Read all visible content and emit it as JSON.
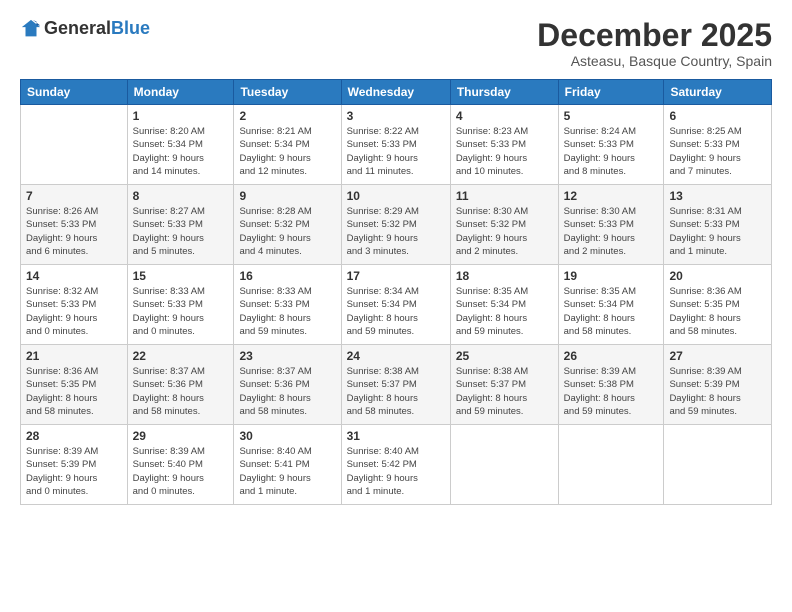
{
  "logo": {
    "general": "General",
    "blue": "Blue"
  },
  "header": {
    "month": "December 2025",
    "location": "Asteasu, Basque Country, Spain"
  },
  "weekdays": [
    "Sunday",
    "Monday",
    "Tuesday",
    "Wednesday",
    "Thursday",
    "Friday",
    "Saturday"
  ],
  "weeks": [
    [
      {
        "day": "",
        "info": ""
      },
      {
        "day": "1",
        "info": "Sunrise: 8:20 AM\nSunset: 5:34 PM\nDaylight: 9 hours\nand 14 minutes."
      },
      {
        "day": "2",
        "info": "Sunrise: 8:21 AM\nSunset: 5:34 PM\nDaylight: 9 hours\nand 12 minutes."
      },
      {
        "day": "3",
        "info": "Sunrise: 8:22 AM\nSunset: 5:33 PM\nDaylight: 9 hours\nand 11 minutes."
      },
      {
        "day": "4",
        "info": "Sunrise: 8:23 AM\nSunset: 5:33 PM\nDaylight: 9 hours\nand 10 minutes."
      },
      {
        "day": "5",
        "info": "Sunrise: 8:24 AM\nSunset: 5:33 PM\nDaylight: 9 hours\nand 8 minutes."
      },
      {
        "day": "6",
        "info": "Sunrise: 8:25 AM\nSunset: 5:33 PM\nDaylight: 9 hours\nand 7 minutes."
      }
    ],
    [
      {
        "day": "7",
        "info": "Sunrise: 8:26 AM\nSunset: 5:33 PM\nDaylight: 9 hours\nand 6 minutes."
      },
      {
        "day": "8",
        "info": "Sunrise: 8:27 AM\nSunset: 5:33 PM\nDaylight: 9 hours\nand 5 minutes."
      },
      {
        "day": "9",
        "info": "Sunrise: 8:28 AM\nSunset: 5:32 PM\nDaylight: 9 hours\nand 4 minutes."
      },
      {
        "day": "10",
        "info": "Sunrise: 8:29 AM\nSunset: 5:32 PM\nDaylight: 9 hours\nand 3 minutes."
      },
      {
        "day": "11",
        "info": "Sunrise: 8:30 AM\nSunset: 5:32 PM\nDaylight: 9 hours\nand 2 minutes."
      },
      {
        "day": "12",
        "info": "Sunrise: 8:30 AM\nSunset: 5:33 PM\nDaylight: 9 hours\nand 2 minutes."
      },
      {
        "day": "13",
        "info": "Sunrise: 8:31 AM\nSunset: 5:33 PM\nDaylight: 9 hours\nand 1 minute."
      }
    ],
    [
      {
        "day": "14",
        "info": "Sunrise: 8:32 AM\nSunset: 5:33 PM\nDaylight: 9 hours\nand 0 minutes."
      },
      {
        "day": "15",
        "info": "Sunrise: 8:33 AM\nSunset: 5:33 PM\nDaylight: 9 hours\nand 0 minutes."
      },
      {
        "day": "16",
        "info": "Sunrise: 8:33 AM\nSunset: 5:33 PM\nDaylight: 8 hours\nand 59 minutes."
      },
      {
        "day": "17",
        "info": "Sunrise: 8:34 AM\nSunset: 5:34 PM\nDaylight: 8 hours\nand 59 minutes."
      },
      {
        "day": "18",
        "info": "Sunrise: 8:35 AM\nSunset: 5:34 PM\nDaylight: 8 hours\nand 59 minutes."
      },
      {
        "day": "19",
        "info": "Sunrise: 8:35 AM\nSunset: 5:34 PM\nDaylight: 8 hours\nand 58 minutes."
      },
      {
        "day": "20",
        "info": "Sunrise: 8:36 AM\nSunset: 5:35 PM\nDaylight: 8 hours\nand 58 minutes."
      }
    ],
    [
      {
        "day": "21",
        "info": "Sunrise: 8:36 AM\nSunset: 5:35 PM\nDaylight: 8 hours\nand 58 minutes."
      },
      {
        "day": "22",
        "info": "Sunrise: 8:37 AM\nSunset: 5:36 PM\nDaylight: 8 hours\nand 58 minutes."
      },
      {
        "day": "23",
        "info": "Sunrise: 8:37 AM\nSunset: 5:36 PM\nDaylight: 8 hours\nand 58 minutes."
      },
      {
        "day": "24",
        "info": "Sunrise: 8:38 AM\nSunset: 5:37 PM\nDaylight: 8 hours\nand 58 minutes."
      },
      {
        "day": "25",
        "info": "Sunrise: 8:38 AM\nSunset: 5:37 PM\nDaylight: 8 hours\nand 59 minutes."
      },
      {
        "day": "26",
        "info": "Sunrise: 8:39 AM\nSunset: 5:38 PM\nDaylight: 8 hours\nand 59 minutes."
      },
      {
        "day": "27",
        "info": "Sunrise: 8:39 AM\nSunset: 5:39 PM\nDaylight: 8 hours\nand 59 minutes."
      }
    ],
    [
      {
        "day": "28",
        "info": "Sunrise: 8:39 AM\nSunset: 5:39 PM\nDaylight: 9 hours\nand 0 minutes."
      },
      {
        "day": "29",
        "info": "Sunrise: 8:39 AM\nSunset: 5:40 PM\nDaylight: 9 hours\nand 0 minutes."
      },
      {
        "day": "30",
        "info": "Sunrise: 8:40 AM\nSunset: 5:41 PM\nDaylight: 9 hours\nand 1 minute."
      },
      {
        "day": "31",
        "info": "Sunrise: 8:40 AM\nSunset: 5:42 PM\nDaylight: 9 hours\nand 1 minute."
      },
      {
        "day": "",
        "info": ""
      },
      {
        "day": "",
        "info": ""
      },
      {
        "day": "",
        "info": ""
      }
    ]
  ]
}
